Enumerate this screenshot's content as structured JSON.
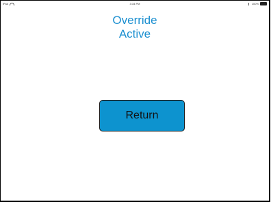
{
  "status_bar": {
    "carrier": "iPad",
    "time": "3:34 PM",
    "battery": "100%"
  },
  "screen": {
    "title_line1": "Override",
    "title_line2": "Active",
    "return_label": "Return"
  },
  "colors": {
    "accent": "#1b8fd0",
    "button": "#0d93cf"
  }
}
